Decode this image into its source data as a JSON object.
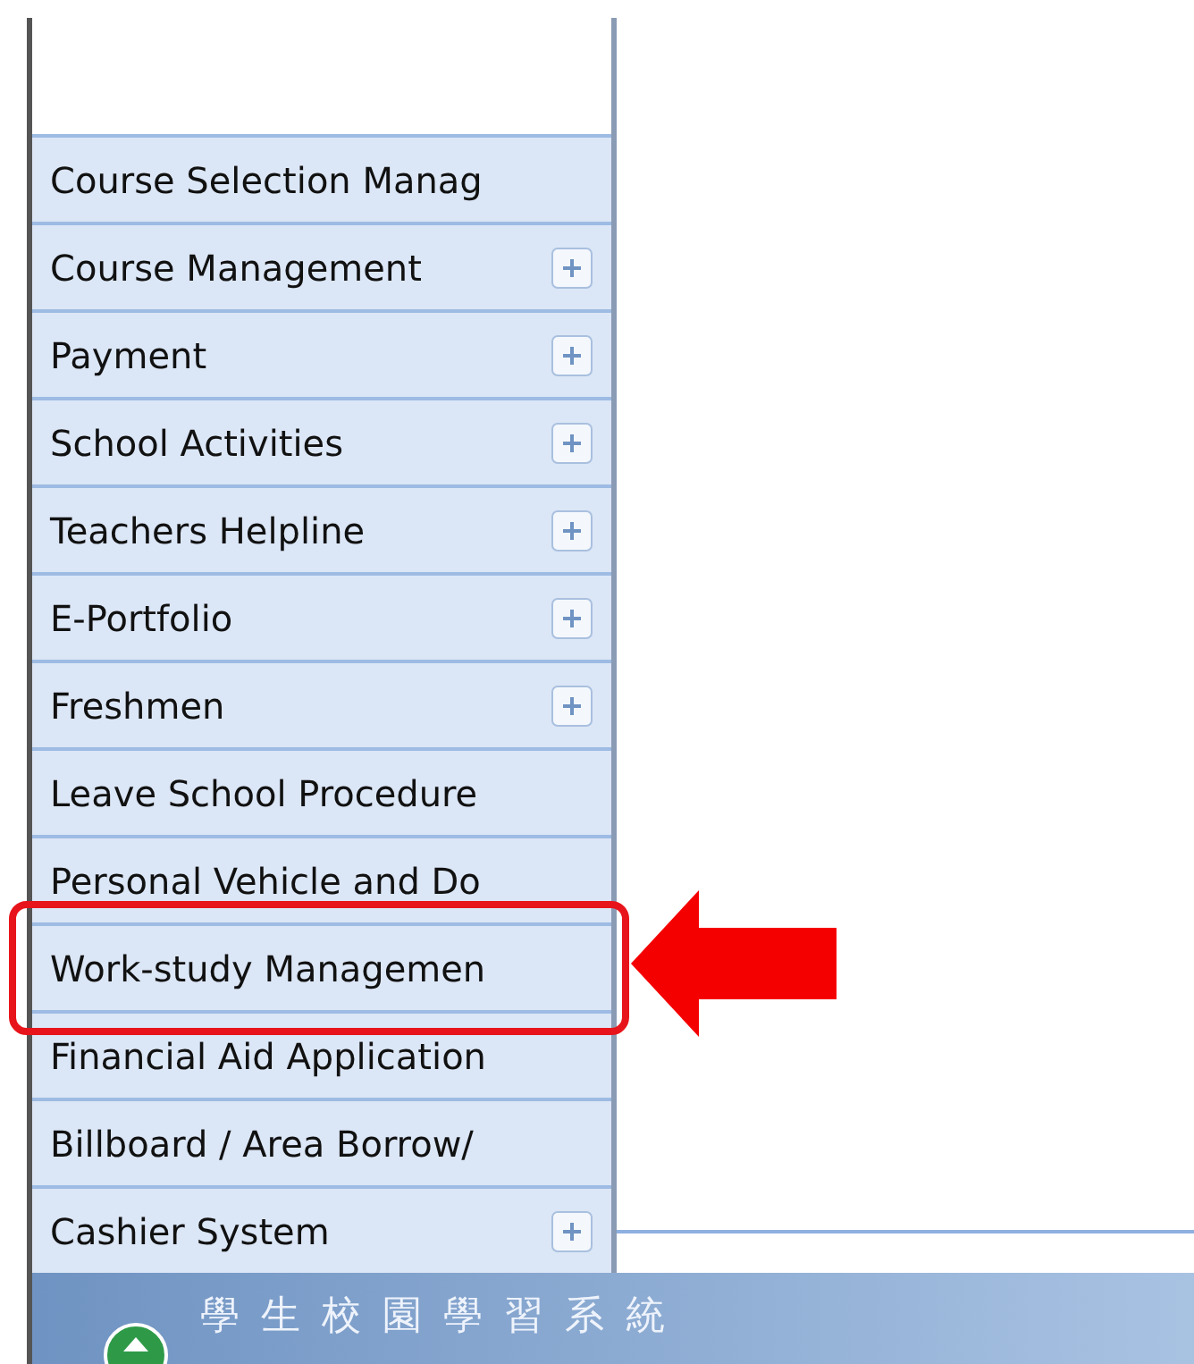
{
  "menu": {
    "items": [
      {
        "label": "Course Selection Manag",
        "expandable": false,
        "highlighted": false
      },
      {
        "label": "Course Management",
        "expandable": true,
        "highlighted": false
      },
      {
        "label": "Payment",
        "expandable": true,
        "highlighted": false
      },
      {
        "label": "School Activities",
        "expandable": true,
        "highlighted": false
      },
      {
        "label": "Teachers Helpline",
        "expandable": true,
        "highlighted": false
      },
      {
        "label": "E-Portfolio",
        "expandable": true,
        "highlighted": false
      },
      {
        "label": "Freshmen",
        "expandable": true,
        "highlighted": false
      },
      {
        "label": "Leave School Procedure",
        "expandable": false,
        "highlighted": false
      },
      {
        "label": "Personal Vehicle and Do",
        "expandable": false,
        "highlighted": false
      },
      {
        "label": "Work-study Managemen",
        "expandable": false,
        "highlighted": true
      },
      {
        "label": "Financial Aid Application",
        "expandable": false,
        "highlighted": false
      },
      {
        "label": "Billboard / Area Borrow/",
        "expandable": false,
        "highlighted": false
      },
      {
        "label": "Cashier System",
        "expandable": true,
        "highlighted": false
      }
    ]
  },
  "footer": {
    "title": "學生校園學習系統"
  }
}
